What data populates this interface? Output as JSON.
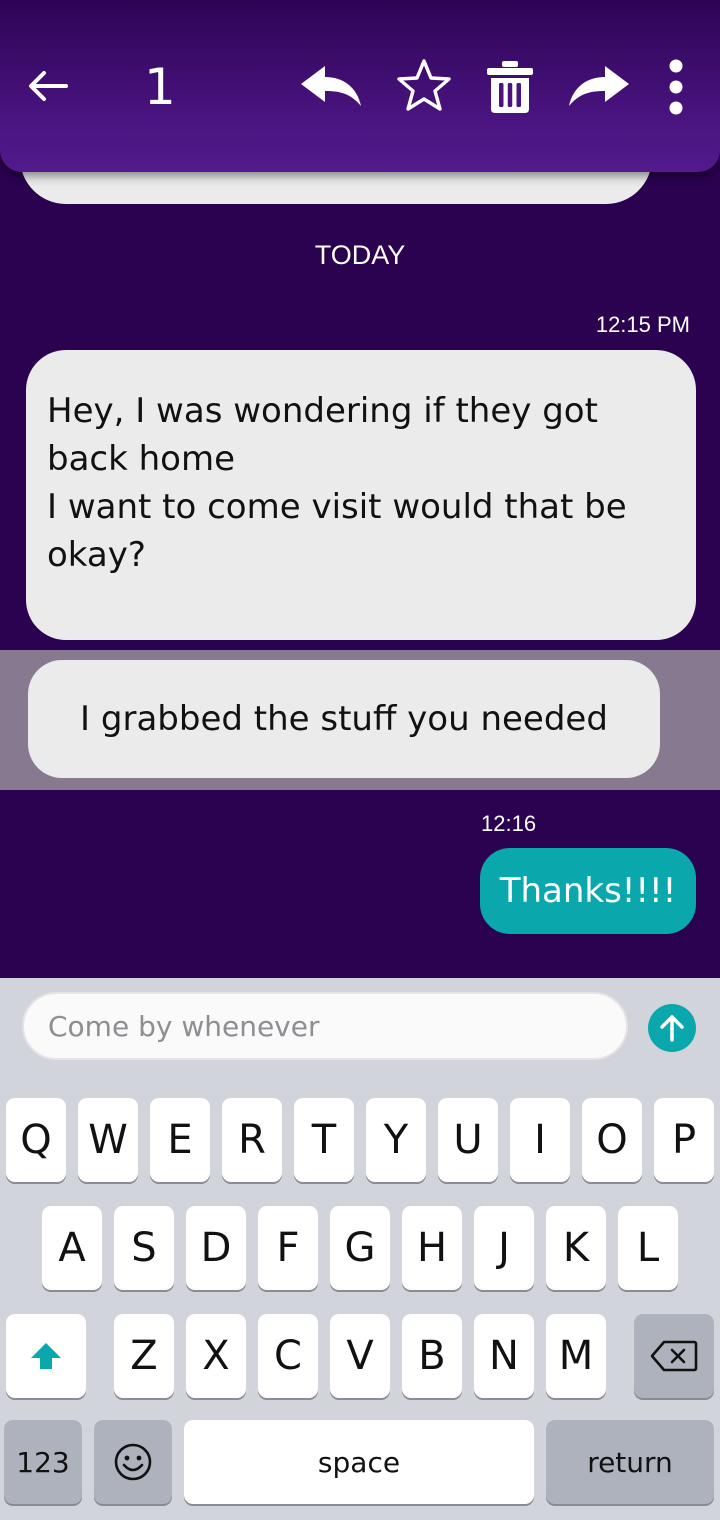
{
  "toolbar": {
    "selected_count": "1",
    "icons": [
      "back-arrow-icon",
      "reply-icon",
      "star-icon",
      "trash-icon",
      "forward-icon",
      "more-vert-icon"
    ]
  },
  "thread": {
    "day_label": "TODAY",
    "messages": [
      {
        "time": "12:15 PM",
        "direction": "incoming",
        "lines": [
          "Hey, I was wondering if they got",
          "back home",
          "I want to come visit would that be",
          "okay?"
        ]
      },
      {
        "direction": "incoming",
        "selected": true,
        "text": "I grabbed the stuff you needed"
      },
      {
        "time": "12:16",
        "direction": "outgoing",
        "text": "Thanks!!!!"
      }
    ]
  },
  "compose": {
    "placeholder": "Come by whenever",
    "value": ""
  },
  "keyboard": {
    "row1": [
      "Q",
      "W",
      "E",
      "R",
      "T",
      "Y",
      "U",
      "I",
      "O",
      "P"
    ],
    "row2": [
      "A",
      "S",
      "D",
      "F",
      "G",
      "H",
      "J",
      "K",
      "L"
    ],
    "row3": [
      "Z",
      "X",
      "C",
      "V",
      "B",
      "N",
      "M"
    ],
    "numbers_label": "123",
    "space_label": "space",
    "return_label": "return"
  },
  "colors": {
    "background": "#2a0250",
    "toolbar": "#4a1480",
    "outgoing_bubble": "#0aa7ad",
    "incoming_bubble": "#ebebeb",
    "selection_highlight": "#877a90"
  }
}
